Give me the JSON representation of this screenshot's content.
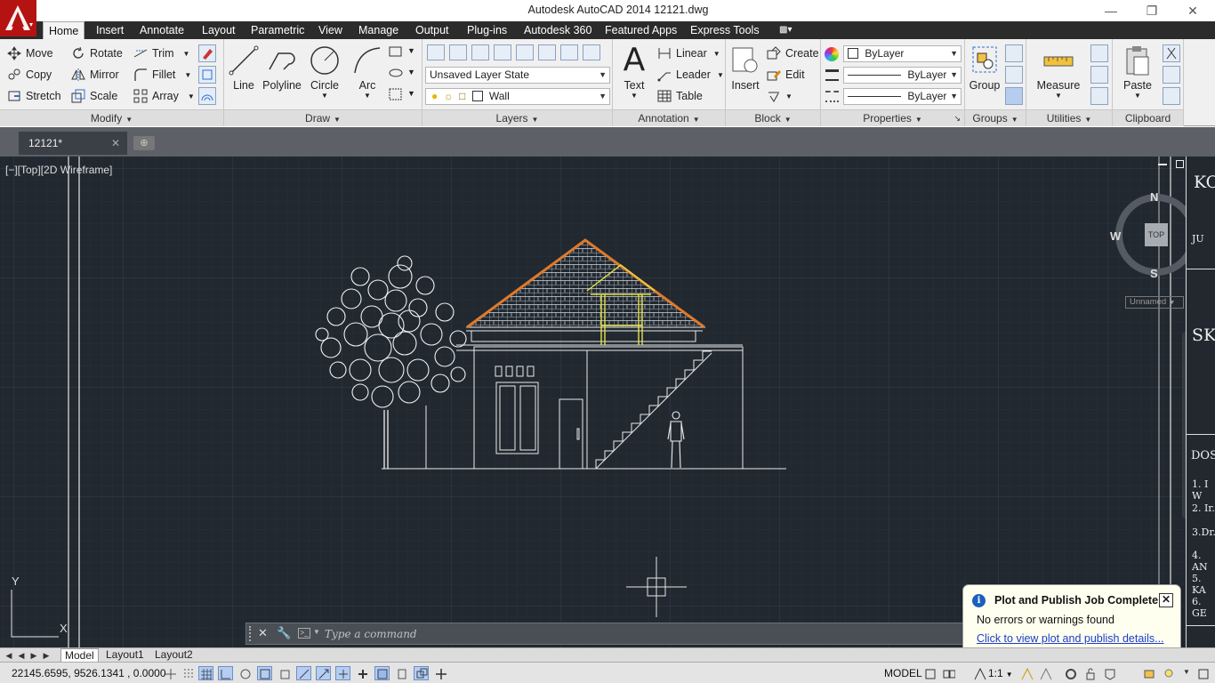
{
  "window": {
    "title": "Autodesk AutoCAD 2014    12121.dwg",
    "controls": [
      "minimize",
      "restore",
      "close"
    ]
  },
  "ribbon_tabs": [
    "Home",
    "Insert",
    "Annotate",
    "Layout",
    "Parametric",
    "View",
    "Manage",
    "Output",
    "Plug-ins",
    "Autodesk 360",
    "Featured Apps",
    "Express Tools"
  ],
  "active_ribbon_tab": "Home",
  "modify": {
    "title": "Modify",
    "move": "Move",
    "rotate": "Rotate",
    "trim": "Trim",
    "copy": "Copy",
    "mirror": "Mirror",
    "fillet": "Fillet",
    "stretch": "Stretch",
    "scale": "Scale",
    "array": "Array"
  },
  "draw": {
    "title": "Draw",
    "line": "Line",
    "polyline": "Polyline",
    "circle": "Circle",
    "arc": "Arc"
  },
  "layers": {
    "title": "Layers",
    "layer_state": "Unsaved Layer State",
    "current_layer": "Wall"
  },
  "annotation": {
    "title": "Annotation",
    "text": "Text",
    "linear": "Linear",
    "leader": "Leader",
    "table": "Table"
  },
  "block": {
    "title": "Block",
    "insert": "Insert",
    "create": "Create",
    "edit": "Edit"
  },
  "properties": {
    "title": "Properties",
    "color": "ByLayer",
    "linetype": "ByLayer",
    "lineweight": "ByLayer"
  },
  "groups": {
    "title": "Groups",
    "group": "Group"
  },
  "utilities": {
    "title": "Utilities",
    "measure": "Measure"
  },
  "clipboard": {
    "title": "Clipboard",
    "paste": "Paste"
  },
  "file_tab": {
    "name": "12121*"
  },
  "viewport": {
    "label": "[−][Top][2D Wireframe]",
    "viewcube": {
      "north": "N",
      "south": "S",
      "east": "E",
      "west": "W",
      "face": "TOP",
      "ucs": "Unnamed"
    },
    "ucs_axes": {
      "y": "Y",
      "x": "X"
    }
  },
  "right_doc": {
    "lines": [
      "KO",
      "JU",
      "SK",
      "DOS",
      "1. I W",
      "2. Ir.",
      "3.Dr.",
      "4. AN",
      "5. KA",
      "6. GE"
    ]
  },
  "command_line": {
    "placeholder": "Type a command"
  },
  "notification": {
    "title": "Plot and Publish Job Complete",
    "body": "No errors or warnings found",
    "link": "Click to view plot and publish details..."
  },
  "layout_tabs": [
    "Model",
    "Layout1",
    "Layout2"
  ],
  "active_layout_tab": "Model",
  "status": {
    "coordinates": "22145.6595, 9526.1341 , 0.0000",
    "space": "MODEL",
    "annotation_scale": "1:1"
  },
  "colors": {
    "canvas": "#212830",
    "roof_hatch": "#e07a2a",
    "highlight_frame": "#e6e34a",
    "title_bar_red": "#b51212"
  }
}
